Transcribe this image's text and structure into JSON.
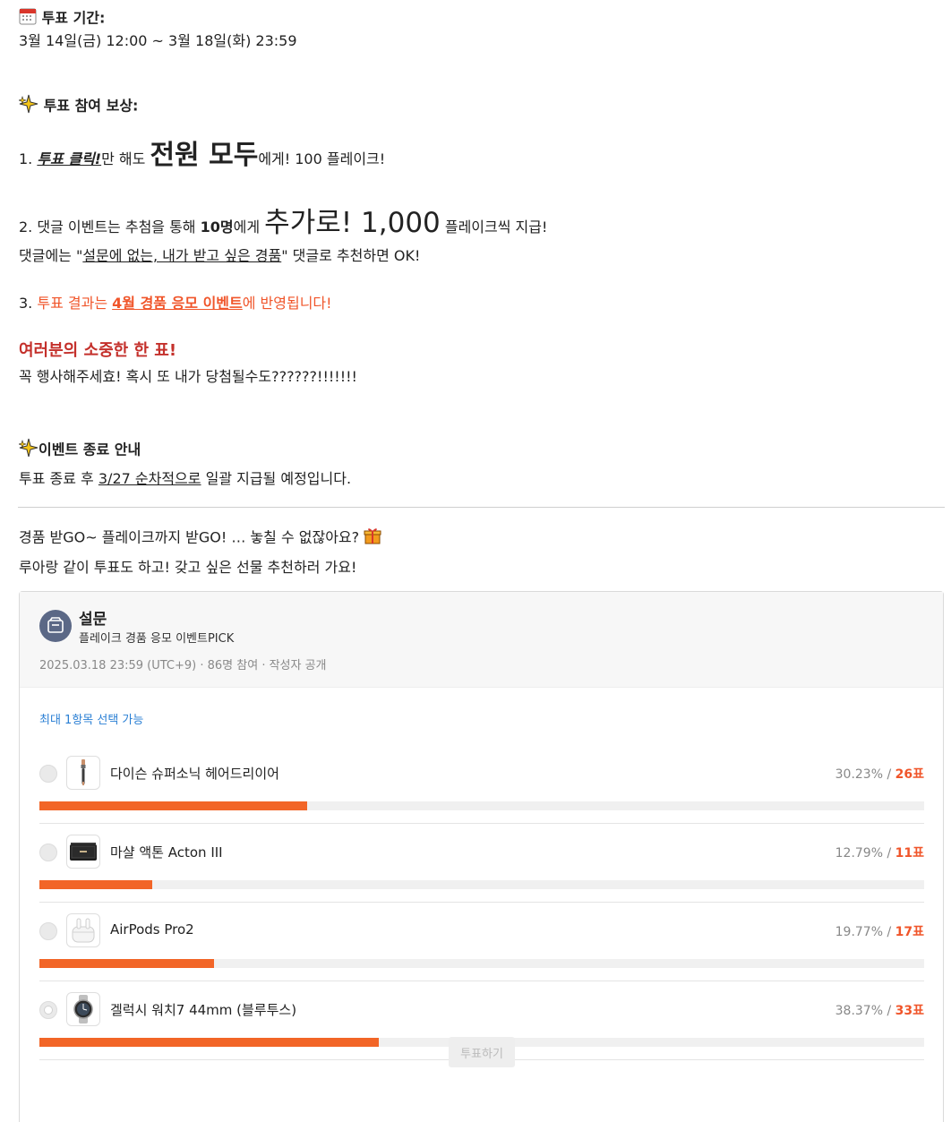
{
  "vote_period": {
    "icon": "calendar-icon",
    "label": "투표 기간:",
    "dates": "3월 14일(금) 12:00  ~ 3월 18일(화) 23:59"
  },
  "reward": {
    "icon": "sparkle-icon",
    "label": "투표 참여 보상:",
    "item1": {
      "num": "1.",
      "click": "투표 클릭!",
      "mid": "만 해도",
      "big": "전원 모두",
      "end": "에게!  100 플레이크!"
    },
    "item2": {
      "prefix": "2. 댓글 이벤트는 추첨을 통해",
      "count": "10명",
      "mid": "에게",
      "big": "추가로! 1,000",
      "end": "플레이크씩 지급!"
    },
    "item2_line2": {
      "prefix": "댓글에는 \"",
      "underlined": "설문에 없는, 내가 받고 싶은 경품",
      "suffix": "\"  댓글로 추천하면 OK!"
    },
    "item3": {
      "num": "3.",
      "text1": "투표 결과는",
      "link": "4월 경품 응모 이벤트",
      "text2": "에 반영됩니다!"
    }
  },
  "precious": {
    "title": "여러분의 소중한 한 표!",
    "text": "꼭 행사해주세효!  혹시 또 내가 당첨될수도??????!!!!!!!"
  },
  "event_end": {
    "icon": "sparkle-icon",
    "label": "이벤트 종료 안내",
    "prefix": "투표 종료 후",
    "underlined": "3/27 순차적으로",
    "suffix": "일괄 지급될 예정입니다."
  },
  "promo": {
    "line1": "경품 받GO~ 플레이크까지 받GO! … 놓칠 수 없잖아요?",
    "line1_icon": "gift-icon",
    "line2": "루아랑 같이 투표도 하고! 갖고 싶은 선물 추천하러 가요!"
  },
  "poll": {
    "icon": "survey-icon",
    "title": "설문",
    "subtitle": "플레이크 경품 응모 이벤트PICK",
    "meta": "2025.03.18 23:59 (UTC+9) · 86명 참여 · 작성자 공개",
    "limit": "최대 1항목 선택 가능",
    "options": [
      {
        "name": "다이슨 슈퍼소닉 헤어드리이어",
        "percent": "30.23% / ",
        "count": "26표",
        "ratio": 0.3023,
        "thumb": "hair-dryer-icon"
      },
      {
        "name": "마샬 액톤 Acton III",
        "percent": "12.79% / ",
        "count": "11표",
        "ratio": 0.1279,
        "thumb": "speaker-icon"
      },
      {
        "name": "AirPods Pro2",
        "percent": "19.77% / ",
        "count": "17표",
        "ratio": 0.1977,
        "thumb": "earbuds-icon"
      },
      {
        "name": "겔럭시 워치7 44mm (블루투스)",
        "percent": "38.37% / ",
        "count": "33표",
        "ratio": 0.3837,
        "thumb": "smartwatch-icon"
      }
    ],
    "vote_button": "투표하기"
  }
}
